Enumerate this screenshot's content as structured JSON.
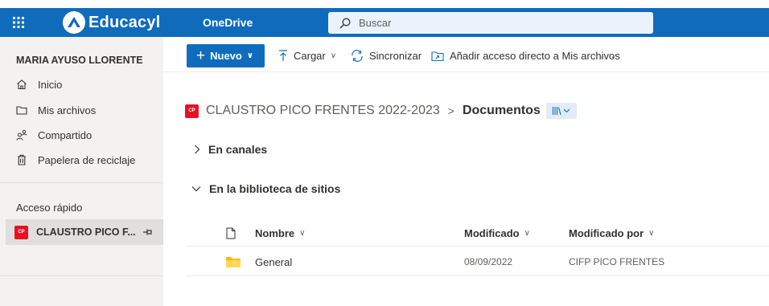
{
  "header": {
    "brand": "Educacyl",
    "product": "OneDrive",
    "search_placeholder": "Buscar",
    "colors": {
      "bar": "#0f6cbd",
      "search_bg": "#eaf3fb"
    }
  },
  "sidebar": {
    "user_name": "MARIA AYUSO LLORENTE",
    "items": [
      {
        "label": "Inicio",
        "icon": "home-icon"
      },
      {
        "label": "Mis archivos",
        "icon": "folder-icon"
      },
      {
        "label": "Compartido",
        "icon": "people-icon"
      },
      {
        "label": "Papelera de reciclaje",
        "icon": "trash-icon"
      }
    ],
    "quick_access_title": "Acceso rápido",
    "quick_access_items": [
      {
        "label": "CLAUSTRO PICO F...",
        "badge": "CP",
        "icon": "pin-icon"
      }
    ]
  },
  "toolbar": {
    "new_label": "Nuevo",
    "upload_label": "Cargar",
    "sync_label": "Sincronizar",
    "shortcut_label": "Añadir acceso directo a Mis archivos",
    "more_label": "···"
  },
  "breadcrumb": {
    "site_badge": "CP",
    "site": "CLAUSTRO PICO FRENTES 2022-2023",
    "separator": ">",
    "current": "Documentos"
  },
  "sections": {
    "channels": "En canales",
    "site_library": "En la biblioteca de sitios"
  },
  "table": {
    "columns": {
      "name": "Nombre",
      "modified": "Modificado",
      "modified_by": "Modificado por"
    },
    "rows": [
      {
        "name": "General",
        "modified": "08/09/2022",
        "modified_by": "CIFP PICO FRENTES"
      }
    ]
  }
}
